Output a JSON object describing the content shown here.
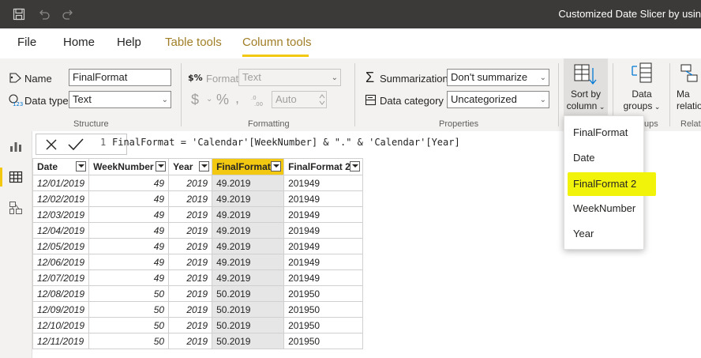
{
  "window": {
    "title": "Customized Date Slicer by usin"
  },
  "tabs": [
    {
      "label": "File"
    },
    {
      "label": "Home"
    },
    {
      "label": "Help"
    },
    {
      "label": "Table tools"
    },
    {
      "label": "Column tools"
    }
  ],
  "ribbon": {
    "structure": {
      "name_label": "Name",
      "name_value": "FinalFormat",
      "datatype_label": "Data type",
      "datatype_value": "Text",
      "group_label": "Structure"
    },
    "formatting": {
      "format_label": "Format",
      "format_value": "Text",
      "currency_symbol": "$",
      "percent_symbol": "%",
      "comma_symbol": ",",
      "decimals_value": "Auto",
      "group_label": "Formatting"
    },
    "properties": {
      "summarization_label": "Summarization",
      "summarization_value": "Don't summarize",
      "category_label": "Data category",
      "category_value": "Uncategorized",
      "group_label": "Properties"
    },
    "sort": {
      "label_line1": "Sort by",
      "label_line2": "column"
    },
    "data_groups": {
      "label_line1": "Data",
      "label_line2": "groups",
      "group_label_partial": "ups"
    },
    "relationships": {
      "label_line1": "Ma",
      "label_line2": "relatio",
      "group_label_partial": "Relati"
    }
  },
  "formula": {
    "line": "1",
    "text": "FinalFormat = 'Calendar'[WeekNumber] & \".\" & 'Calendar'[Year]"
  },
  "table": {
    "columns": [
      "Date",
      "WeekNumber",
      "Year",
      "FinalFormat",
      "FinalFormat 2"
    ],
    "rows": [
      [
        "12/01/2019",
        "49",
        "2019",
        "49.2019",
        "201949"
      ],
      [
        "12/02/2019",
        "49",
        "2019",
        "49.2019",
        "201949"
      ],
      [
        "12/03/2019",
        "49",
        "2019",
        "49.2019",
        "201949"
      ],
      [
        "12/04/2019",
        "49",
        "2019",
        "49.2019",
        "201949"
      ],
      [
        "12/05/2019",
        "49",
        "2019",
        "49.2019",
        "201949"
      ],
      [
        "12/06/2019",
        "49",
        "2019",
        "49.2019",
        "201949"
      ],
      [
        "12/07/2019",
        "49",
        "2019",
        "49.2019",
        "201949"
      ],
      [
        "12/08/2019",
        "50",
        "2019",
        "50.2019",
        "201950"
      ],
      [
        "12/09/2019",
        "50",
        "2019",
        "50.2019",
        "201950"
      ],
      [
        "12/10/2019",
        "50",
        "2019",
        "50.2019",
        "201950"
      ],
      [
        "12/11/2019",
        "50",
        "2019",
        "50.2019",
        "201950"
      ]
    ]
  },
  "sort_menu": {
    "items": [
      "FinalFormat",
      "Date",
      "FinalFormat 2",
      "WeekNumber",
      "Year"
    ],
    "highlighted": "FinalFormat 2"
  },
  "colors": {
    "accent": "#f2c811",
    "highlight": "#f2f30a",
    "titlebar": "#3b3a39"
  },
  "icons": [
    "save-icon",
    "undo-icon",
    "redo-icon",
    "tag-icon",
    "datatype-icon",
    "currency-icon",
    "sigma-icon",
    "category-icon",
    "sort-by-column-icon",
    "data-groups-icon",
    "report-view-icon",
    "data-view-icon",
    "model-view-icon",
    "cancel-icon",
    "commit-icon"
  ]
}
